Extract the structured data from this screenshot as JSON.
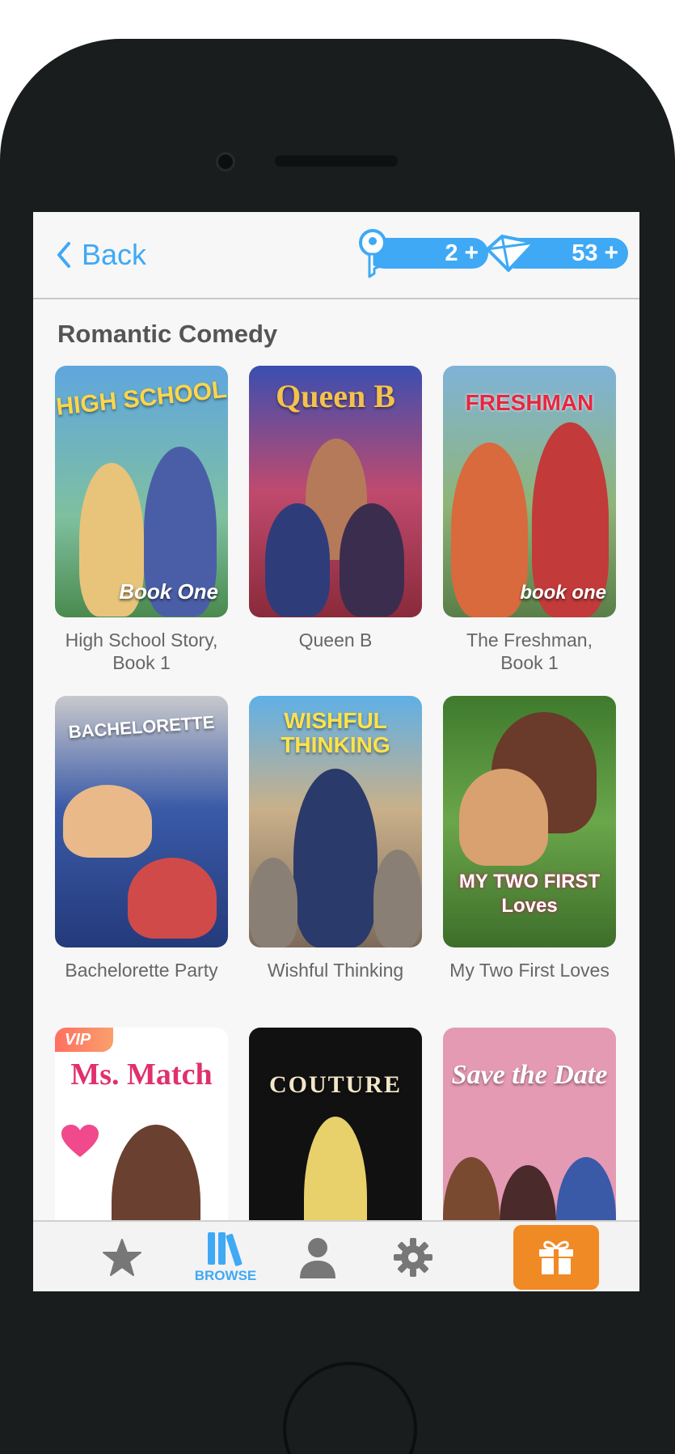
{
  "header": {
    "back_label": "Back",
    "keys_count": "2",
    "gems_count": "53",
    "plus": "+"
  },
  "section": {
    "title": "Romantic Comedy"
  },
  "stories": [
    {
      "label": "High School Story, Book 1",
      "cover_title": "HIGH SCHOOL",
      "cover_sub": "Book One",
      "bg": "#6aa9d8"
    },
    {
      "label": "Queen B",
      "cover_title": "Queen B",
      "bg": "#c4506e"
    },
    {
      "label": "The Freshman, Book 1",
      "cover_title": "FRESHMAN",
      "cover_sub": "book one",
      "bg": "#5e9b72"
    },
    {
      "label": "Bachelorette Party",
      "cover_title": "BACHELORETTE",
      "bg": "#2d4e9a"
    },
    {
      "label": "Wishful Thinking",
      "cover_title": "WISHFUL THINKING",
      "bg": "#8aa2b8"
    },
    {
      "label": "My Two First Loves",
      "cover_title": "MY TWO FIRST Loves",
      "bg": "#4f8f3a"
    },
    {
      "label": "",
      "cover_title": "Ms. Match",
      "bg": "#ffffff",
      "badge": "VIP"
    },
    {
      "label": "",
      "cover_title": "COUTURE",
      "bg": "#111111"
    },
    {
      "label": "",
      "cover_title": "Save the Date",
      "bg": "#e59ab4"
    }
  ],
  "tabs": {
    "browse_label": "BROWSE"
  },
  "colors": {
    "accent": "#3fa9f5",
    "gift": "#f08a24",
    "icon_gray": "#777777"
  }
}
